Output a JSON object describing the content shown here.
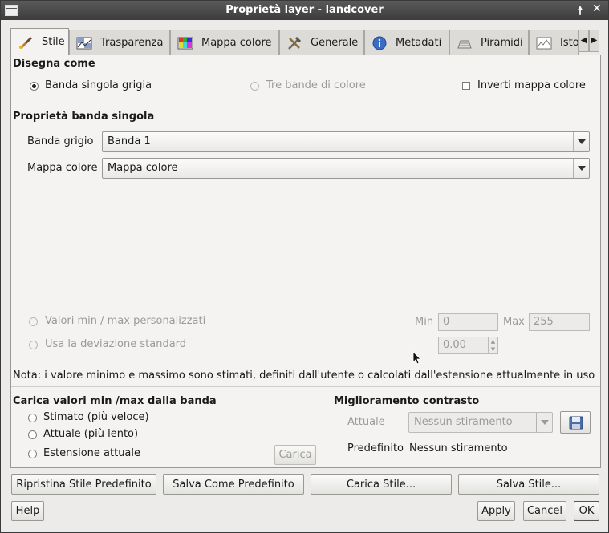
{
  "window": {
    "title": "Proprietà layer - landcover",
    "pin_glyph": "🠕",
    "close_glyph": "✕"
  },
  "tabs": [
    {
      "label": "Stile",
      "icon": "brush-icon"
    },
    {
      "label": "Trasparenza",
      "icon": "transparency-icon"
    },
    {
      "label": "Mappa colore",
      "icon": "colormap-icon"
    },
    {
      "label": "Generale",
      "icon": "tools-icon"
    },
    {
      "label": "Metadati",
      "icon": "info-icon"
    },
    {
      "label": "Piramidi",
      "icon": "pyramid-icon"
    },
    {
      "label": "Isto",
      "icon": "histogram-icon"
    }
  ],
  "tab_scroll": {
    "left": "◀",
    "right": "▶"
  },
  "draw_as": {
    "heading": "Disegna come",
    "single_gray": "Banda singola grigia",
    "three_bands": "Tre bande di colore",
    "invert": "Inverti mappa colore"
  },
  "single_band": {
    "heading": "Proprietà banda singola",
    "gray_band_label": "Banda grigio",
    "gray_band_value": "Banda 1",
    "colormap_label": "Mappa colore",
    "colormap_value": "Mappa colore"
  },
  "minmax": {
    "custom_label": "Valori min / max personalizzati",
    "stddev_label": "Usa la deviazione standard",
    "min_label": "Min",
    "min_value": "0",
    "max_label": "Max",
    "max_value": "255",
    "stddev_value": "0.00",
    "note": "Nota: i valore minimo e massimo sono stimati, definiti dall'utente o calcolati dall'estensione attualmente in uso"
  },
  "load_minmax": {
    "heading": "Carica valori min /max dalla banda",
    "estimated": "Stimato (più veloce)",
    "actual": "Attuale (più lento)",
    "extent": "Estensione attuale",
    "load_button": "Carica"
  },
  "contrast": {
    "heading": "Miglioramento contrasto",
    "current_label": "Attuale",
    "current_value": "Nessun stiramento",
    "default_label": "Predefinito",
    "default_value": "Nessun stiramento"
  },
  "style_buttons": {
    "restore": "Ripristina Stile Predefinito",
    "save_default": "Salva Come Predefinito",
    "load_style": "Carica Stile...",
    "save_style": "Salva Stile..."
  },
  "dialog_buttons": {
    "help": "Help",
    "apply": "Apply",
    "cancel": "Cancel",
    "ok": "OK"
  }
}
